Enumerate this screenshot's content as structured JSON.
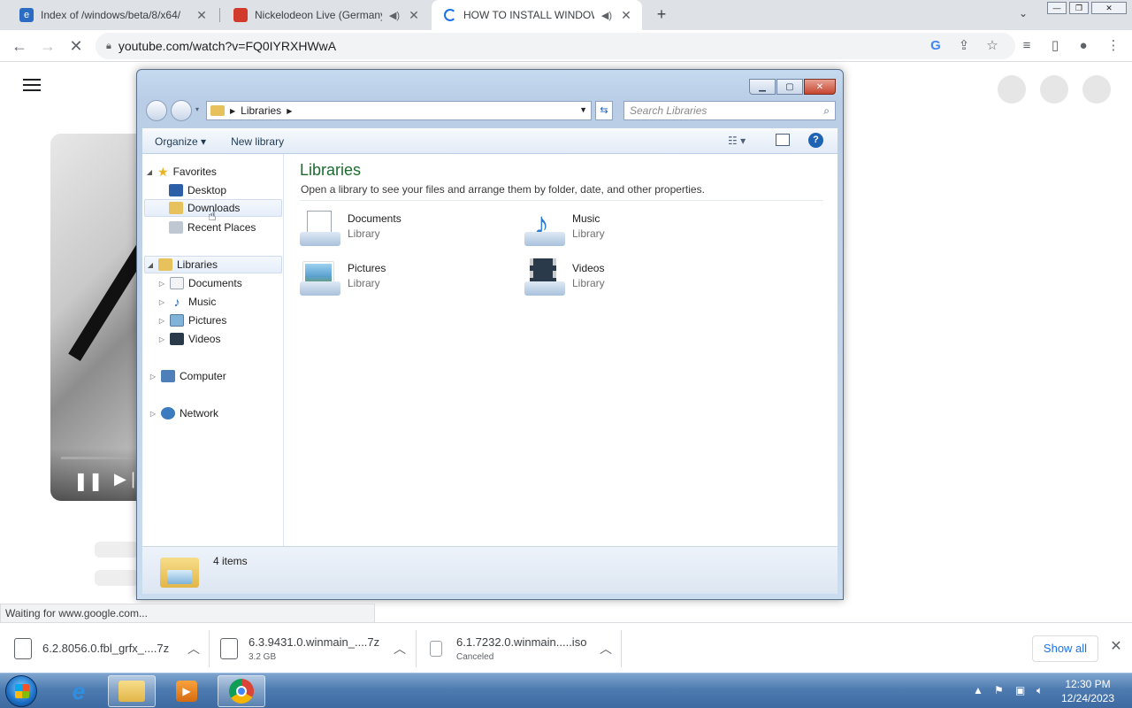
{
  "browser": {
    "tabs": [
      {
        "title": "Index of /windows/beta/8/x64/",
        "favicon": "ie-page-icon",
        "active": false,
        "audio": false
      },
      {
        "title": "Nickelodeon Live (Germany)",
        "favicon": "tv-icon",
        "active": false,
        "audio": true
      },
      {
        "title": "HOW TO INSTALL WINDOW",
        "favicon": "loading-spinner-icon",
        "active": true,
        "audio": true
      }
    ],
    "new_tab_symbol": "+",
    "url": "youtube.com/watch?v=FQ0IYRXHWwA",
    "status_text": "Waiting for www.google.com...",
    "accent_color": "#1a73e8"
  },
  "explorer": {
    "breadcrumb": "Libraries",
    "search_placeholder": "Search Libraries",
    "commands": {
      "organize": "Organize",
      "new_library": "New library"
    },
    "nav": {
      "favorites": {
        "label": "Favorites",
        "items": [
          "Desktop",
          "Downloads",
          "Recent Places"
        ]
      },
      "libraries": {
        "label": "Libraries",
        "items": [
          "Documents",
          "Music",
          "Pictures",
          "Videos"
        ]
      },
      "computer": "Computer",
      "network": "Network"
    },
    "content": {
      "title": "Libraries",
      "description": "Open a library to see your files and arrange them by folder, date, and other properties.",
      "items": [
        {
          "name": "Documents",
          "type": "Library",
          "icon": "documents-library-icon"
        },
        {
          "name": "Music",
          "type": "Library",
          "icon": "music-library-icon"
        },
        {
          "name": "Pictures",
          "type": "Library",
          "icon": "pictures-library-icon"
        },
        {
          "name": "Videos",
          "type": "Library",
          "icon": "videos-library-icon"
        }
      ]
    },
    "status": "4 items"
  },
  "downloads": {
    "items": [
      {
        "name": "6.2.8056.0.fbl_grfx_....7z",
        "detail": ""
      },
      {
        "name": "6.3.9431.0.winmain_....7z",
        "detail": "3.2 GB"
      },
      {
        "name": "6.1.7232.0.winmain.....iso",
        "detail": "Canceled"
      }
    ],
    "show_all": "Show all"
  },
  "taskbar": {
    "time": "12:30 PM",
    "date": "12/24/2023"
  }
}
